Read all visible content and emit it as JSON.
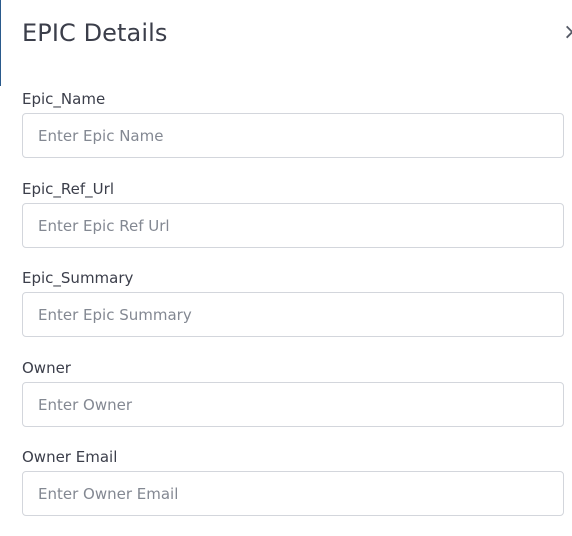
{
  "modal": {
    "title": "EPIC Details",
    "close_glyph": "×"
  },
  "fields": [
    {
      "label": "Epic_Name",
      "value": "",
      "placeholder": "Enter Epic Name"
    },
    {
      "label": "Epic_Ref_Url",
      "value": "",
      "placeholder": "Enter Epic Ref Url"
    },
    {
      "label": "Epic_Summary",
      "value": "",
      "placeholder": "Enter Epic Summary"
    },
    {
      "label": "Owner",
      "value": "",
      "placeholder": "Enter Owner"
    },
    {
      "label": "Owner Email",
      "value": "",
      "placeholder": "Enter Owner Email"
    }
  ]
}
